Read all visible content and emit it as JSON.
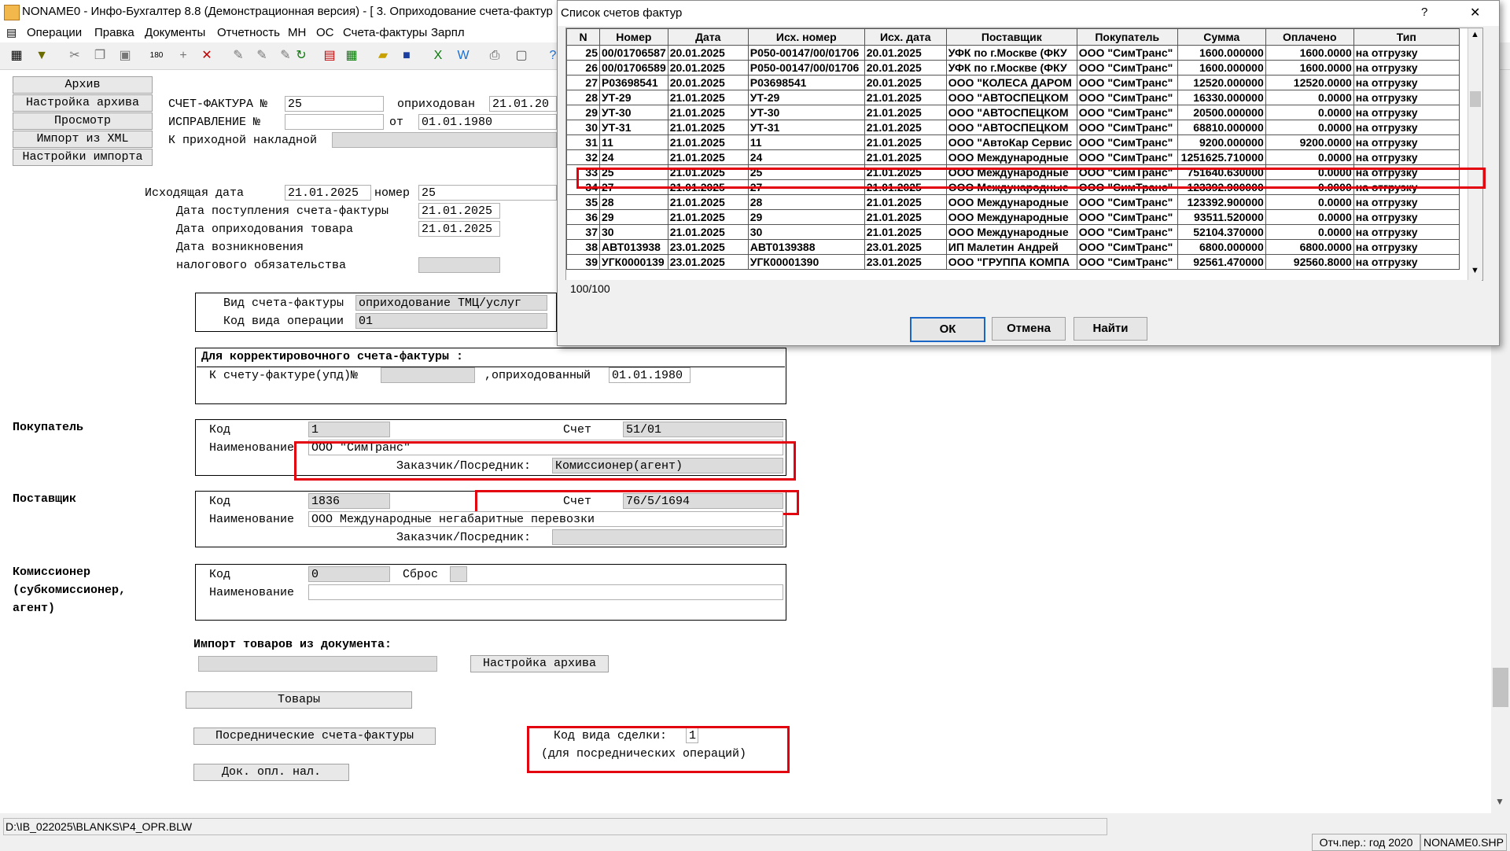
{
  "window": {
    "title": "NONAME0 - Инфо-Бухгалтер 8.8 (Демонстрационная версия) - [  3. Оприходование счета-фактур"
  },
  "menu": [
    "Операции",
    "Правка",
    "Документы",
    "Отчетность",
    "МН",
    "ОС",
    "Счета-фактуры",
    "Зарпл"
  ],
  "left_buttons": {
    "archive": "Архив",
    "archive_settings": "Настройка архива",
    "view": "Просмотр",
    "import_xml": "Импорт из XML",
    "import_settings": "Настройки импорта"
  },
  "form": {
    "invoice_label": "СЧЕТ-ФАКТУРА №",
    "invoice_no": "25",
    "posted_label": "оприходован",
    "posted_date": "21.01.20",
    "correction_label": "ИСПРАВЛЕНИЕ  №",
    "correction_no": "",
    "from_label": "от",
    "from_date": "01.01.1980",
    "to_receipt_label": "К приходной накладной",
    "out_date_label": "Исходящая дата",
    "out_date": "21.01.2025",
    "number_label": "номер",
    "number": "25",
    "receipt_date_label": "Дата поступления счета-фактуры",
    "receipt_date": "21.01.2025",
    "goods_date_label": "Дата оприходования товара",
    "goods_date": "21.01.2025",
    "tax_date_label1": "Дата возникновения",
    "tax_date_label2": "налогового обязательства",
    "kind_label": "Вид счета-фактуры",
    "kind_value": "оприходование ТМЦ/услуг",
    "op_code_label": "Код вида операции",
    "op_code": "01",
    "corr_title": "Для корректировочного счета-фактуры :",
    "corr_to_label": "К счету-фактуре(упд)№",
    "corr_posted_label": ",оприходованный",
    "corr_date": "01.01.1980",
    "buyer_section": "Покупатель",
    "code_label": "Код",
    "buyer_code": "1",
    "account_label": "Счет",
    "buyer_account": "51/01",
    "name_label": "Наименование",
    "buyer_name": "ООО \"СимТранс\"",
    "customer_label": "Заказчик/Посредник:",
    "buyer_customer": "Комиссионер(агент)",
    "supplier_section": "Поставщик",
    "supplier_code": "1836",
    "supplier_account": "76/5/1694",
    "supplier_name": "ООО Международные негабаритные перевозки",
    "commission_section1": "Комиссионер",
    "commission_section2": "(субкомиссионер,",
    "commission_section3": "агент)",
    "commission_code": "0",
    "reset_label": "Сброс",
    "import_goods_label": "Импорт товаров из документа:",
    "archive_settings_btn": "Настройка архива",
    "goods_btn": "Товары",
    "agent_invoices_btn": "Посреднические счета-фактуры",
    "doc_pay_btn": "Док. опл. нал.",
    "deal_code_label": "Код вида сделки:",
    "deal_code": "1",
    "deal_code_note": "(для посреднических операций)"
  },
  "dialog": {
    "title": "Список счетов фактур",
    "help": "?",
    "close": "✕",
    "columns": [
      "N",
      "Номер",
      "Дата",
      "Исх. номер",
      "Исх. дата",
      "Поставщик",
      "Покупатель",
      "Сумма",
      "Оплачено",
      "Тип"
    ],
    "rows": [
      [
        "25",
        "00/01706587",
        "20.01.2025",
        "Р050-00147/00/01706",
        "20.01.2025",
        "УФК по г.Москве (ФКУ",
        "ООО \"СимТранс\"",
        "1600.000000",
        "1600.0000",
        "на отгрузку"
      ],
      [
        "26",
        "00/01706589",
        "20.01.2025",
        "Р050-00147/00/01706",
        "20.01.2025",
        "УФК по г.Москве (ФКУ",
        "ООО \"СимТранс\"",
        "1600.000000",
        "1600.0000",
        "на отгрузку"
      ],
      [
        "27",
        "Р03698541",
        "20.01.2025",
        "Р03698541",
        "20.01.2025",
        "ООО \"КОЛЕСА ДАРОМ",
        "ООО \"СимТранс\"",
        "12520.000000",
        "12520.0000",
        "на отгрузку"
      ],
      [
        "28",
        "УТ-29",
        "21.01.2025",
        "УТ-29",
        "21.01.2025",
        "ООО \"АВТОСПЕЦКОМ",
        "ООО \"СимТранс\"",
        "16330.000000",
        "0.0000",
        "на отгрузку"
      ],
      [
        "29",
        "УТ-30",
        "21.01.2025",
        "УТ-30",
        "21.01.2025",
        "ООО \"АВТОСПЕЦКОМ",
        "ООО \"СимТранс\"",
        "20500.000000",
        "0.0000",
        "на отгрузку"
      ],
      [
        "30",
        "УТ-31",
        "21.01.2025",
        "УТ-31",
        "21.01.2025",
        "ООО \"АВТОСПЕЦКОМ",
        "ООО \"СимТранс\"",
        "68810.000000",
        "0.0000",
        "на отгрузку"
      ],
      [
        "31",
        "11",
        "21.01.2025",
        "11",
        "21.01.2025",
        "ООО \"АвтоКар Сервис",
        "ООО \"СимТранс\"",
        "9200.000000",
        "9200.0000",
        "на отгрузку"
      ],
      [
        "32",
        "24",
        "21.01.2025",
        "24",
        "21.01.2025",
        "ООО Международные",
        "ООО \"СимТранс\"",
        "1251625.710000",
        "0.0000",
        "на отгрузку"
      ],
      [
        "33",
        "25",
        "21.01.2025",
        "25",
        "21.01.2025",
        "ООО Международные",
        "ООО \"СимТранс\"",
        "751640.630000",
        "0.0000",
        "на отгрузку"
      ],
      [
        "34",
        "27",
        "21.01.2025",
        "27",
        "21.01.2025",
        "ООО Международные",
        "ООО \"СимТранс\"",
        "123392.900000",
        "0.0000",
        "на отгрузку"
      ],
      [
        "35",
        "28",
        "21.01.2025",
        "28",
        "21.01.2025",
        "ООО Международные",
        "ООО \"СимТранс\"",
        "123392.900000",
        "0.0000",
        "на отгрузку"
      ],
      [
        "36",
        "29",
        "21.01.2025",
        "29",
        "21.01.2025",
        "ООО Международные",
        "ООО \"СимТранс\"",
        "93511.520000",
        "0.0000",
        "на отгрузку"
      ],
      [
        "37",
        "30",
        "21.01.2025",
        "30",
        "21.01.2025",
        "ООО Международные",
        "ООО \"СимТранс\"",
        "52104.370000",
        "0.0000",
        "на отгрузку"
      ],
      [
        "38",
        "АВТ013938",
        "23.01.2025",
        "АВТ0139388",
        "23.01.2025",
        "ИП Малетин Андрей",
        "ООО \"СимТранс\"",
        "6800.000000",
        "6800.0000",
        "на отгрузку"
      ],
      [
        "39",
        "УГК0000139",
        "23.01.2025",
        "УГК00001390",
        "23.01.2025",
        "ООО \"ГРУППА КОМПА",
        "ООО \"СимТранс\"",
        "92561.470000",
        "92560.8000",
        "на отгрузку"
      ]
    ],
    "counter": "100/100",
    "ok": "ОК",
    "cancel": "Отмена",
    "find": "Найти"
  },
  "status": {
    "path": "D:\\IB_022025\\BLANKS\\P4_OPR.BLW",
    "period": "Отч.пер.: год 2020",
    "file": "NONAME0.SHP"
  }
}
